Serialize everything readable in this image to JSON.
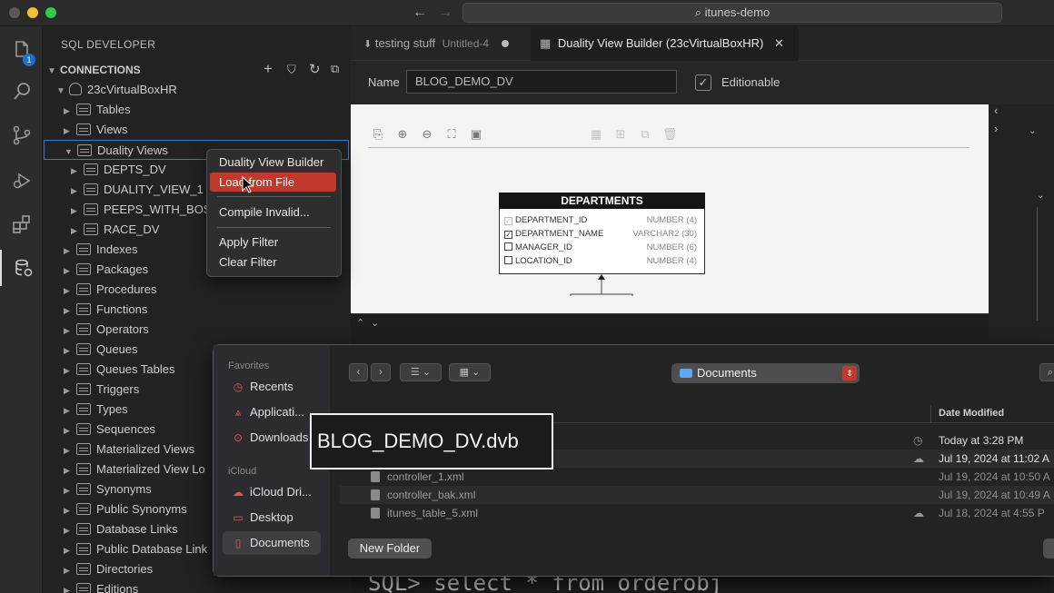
{
  "window": {
    "search_text": "itunes-demo"
  },
  "activity_bar": {
    "explorer_badge": "1"
  },
  "sidebar": {
    "title": "SQL DEVELOPER",
    "section": "CONNECTIONS",
    "connection": "23cVirtualBoxHR",
    "items": [
      {
        "label": "Tables",
        "level": 1,
        "expanded": false
      },
      {
        "label": "Views",
        "level": 1,
        "expanded": false
      },
      {
        "label": "Duality Views",
        "level": 1,
        "expanded": true,
        "selected": true
      },
      {
        "label": "DEPTS_DV",
        "level": 2,
        "expanded": false
      },
      {
        "label": "DUALITY_VIEW_1",
        "level": 2,
        "expanded": false
      },
      {
        "label": "PEEPS_WITH_BOS",
        "level": 2,
        "expanded": false
      },
      {
        "label": "RACE_DV",
        "level": 2,
        "expanded": false
      },
      {
        "label": "Indexes",
        "level": 1,
        "expanded": false
      },
      {
        "label": "Packages",
        "level": 1,
        "expanded": false
      },
      {
        "label": "Procedures",
        "level": 1,
        "expanded": false
      },
      {
        "label": "Functions",
        "level": 1,
        "expanded": false
      },
      {
        "label": "Operators",
        "level": 1,
        "expanded": false
      },
      {
        "label": "Queues",
        "level": 1,
        "expanded": false
      },
      {
        "label": "Queues Tables",
        "level": 1,
        "expanded": false
      },
      {
        "label": "Triggers",
        "level": 1,
        "expanded": false
      },
      {
        "label": "Types",
        "level": 1,
        "expanded": false
      },
      {
        "label": "Sequences",
        "level": 1,
        "expanded": false
      },
      {
        "label": "Materialized Views",
        "level": 1,
        "expanded": false
      },
      {
        "label": "Materialized View Lo",
        "level": 1,
        "expanded": false
      },
      {
        "label": "Synonyms",
        "level": 1,
        "expanded": false
      },
      {
        "label": "Public Synonyms",
        "level": 1,
        "expanded": false
      },
      {
        "label": "Database Links",
        "level": 1,
        "expanded": false
      },
      {
        "label": "Public Database Link",
        "level": 1,
        "expanded": false
      },
      {
        "label": "Directories",
        "level": 1,
        "expanded": false
      },
      {
        "label": "Editions",
        "level": 1,
        "expanded": false
      }
    ]
  },
  "tabs": [
    {
      "label": "testing stuff",
      "sublabel": "Untitled-4",
      "dirty": true
    },
    {
      "label": "Duality View Builder (23cVirtualBoxHR)",
      "active": true
    }
  ],
  "builder": {
    "name_label": "Name",
    "name_value": "BLOG_DEMO_DV",
    "editionable_label": "Editionable",
    "editionable_checked": true,
    "entity": {
      "title": "DEPARTMENTS",
      "columns": [
        {
          "name": "DEPARTMENT_ID",
          "type": "NUMBER (4)",
          "checked": true,
          "dim": true
        },
        {
          "name": "DEPARTMENT_NAME",
          "type": "VARCHAR2 (30)",
          "checked": true
        },
        {
          "name": "MANAGER_ID",
          "type": "NUMBER (6)",
          "checked": false
        },
        {
          "name": "LOCATION_ID",
          "type": "NUMBER (4)",
          "checked": false
        }
      ]
    },
    "sql_prompt": "SQL> select * from orderobj"
  },
  "context_menu": {
    "items": [
      {
        "label": "Duality View Builder"
      },
      {
        "label": "Load from File",
        "active": true
      },
      {
        "label": "Compile Invalid..."
      },
      {
        "label": "Apply Filter"
      },
      {
        "label": "Clear Filter"
      }
    ]
  },
  "file_dialog": {
    "favorites_label": "Favorites",
    "icloud_label": "iCloud",
    "favorites": [
      {
        "label": "Recents",
        "icon": "clock-icon"
      },
      {
        "label": "Applicati...",
        "icon": "apps-icon"
      },
      {
        "label": "Downloads",
        "icon": "download-icon"
      }
    ],
    "icloud": [
      {
        "label": "iCloud Dri...",
        "icon": "cloud-icon"
      },
      {
        "label": "Desktop",
        "icon": "desktop-icon"
      },
      {
        "label": "Documents",
        "icon": "document-icon",
        "selected": true
      }
    ],
    "location": "Documents",
    "column_date": "Date Modified",
    "files": [
      {
        "name": "",
        "date": "Today at 3:28 PM",
        "status": "clock",
        "highlight": true
      },
      {
        "name": "",
        "date": "Jul 19, 2024 at 11:02 A",
        "status": "cloud",
        "highlight": true
      },
      {
        "name": "controller_1.xml",
        "date": "Jul 19, 2024 at 10:50 A",
        "status": ""
      },
      {
        "name": "controller_bak.xml",
        "date": "Jul 19, 2024 at 10:49 A",
        "status": ""
      },
      {
        "name": "itunes_table_5.xml",
        "date": "Jul 18, 2024 at 4:55 P",
        "status": "cloud"
      }
    ],
    "new_folder": "New Folder",
    "filename_overlay": "BLOG_DEMO_DV.dvb"
  }
}
